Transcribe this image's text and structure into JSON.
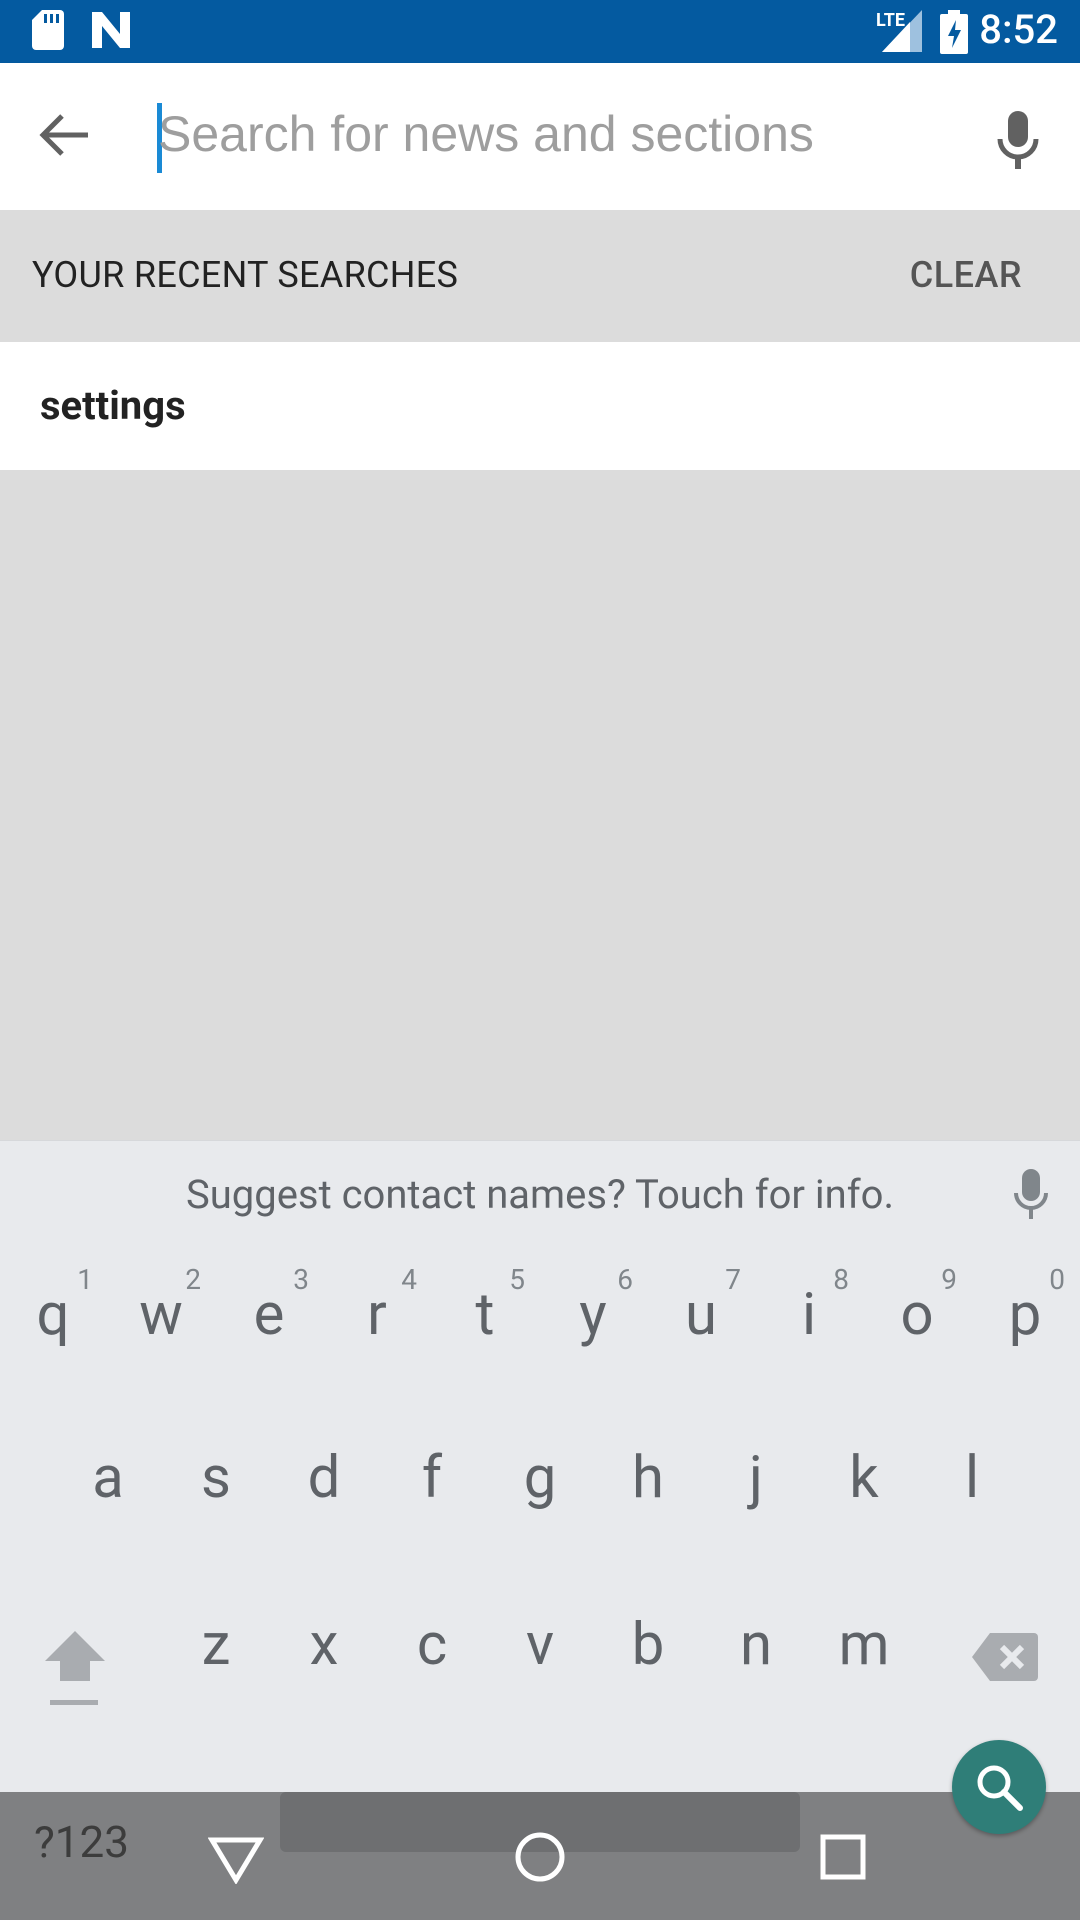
{
  "status_bar": {
    "time": "8:52",
    "network_label": "LTE",
    "icons": [
      "sd-card-icon",
      "n-app-icon",
      "signal-icon",
      "battery-charging-icon"
    ],
    "background_color": "#045aa0"
  },
  "search": {
    "placeholder": "Search for news and sections",
    "value": ""
  },
  "recent": {
    "title": "YOUR RECENT SEARCHES",
    "clear_label": "CLEAR",
    "items": [
      {
        "label": "settings"
      }
    ]
  },
  "keyboard": {
    "suggestion": "Suggest contact names? Touch for info.",
    "row1": [
      {
        "ch": "q",
        "num": "1"
      },
      {
        "ch": "w",
        "num": "2"
      },
      {
        "ch": "e",
        "num": "3"
      },
      {
        "ch": "r",
        "num": "4"
      },
      {
        "ch": "t",
        "num": "5"
      },
      {
        "ch": "y",
        "num": "6"
      },
      {
        "ch": "u",
        "num": "7"
      },
      {
        "ch": "i",
        "num": "8"
      },
      {
        "ch": "o",
        "num": "9"
      },
      {
        "ch": "p",
        "num": "0"
      }
    ],
    "row2": [
      "a",
      "s",
      "d",
      "f",
      "g",
      "h",
      "j",
      "k",
      "l"
    ],
    "row3": [
      "z",
      "x",
      "c",
      "v",
      "b",
      "n",
      "m"
    ],
    "mode_key": "?123",
    "accent_color": "#2f7e78"
  }
}
